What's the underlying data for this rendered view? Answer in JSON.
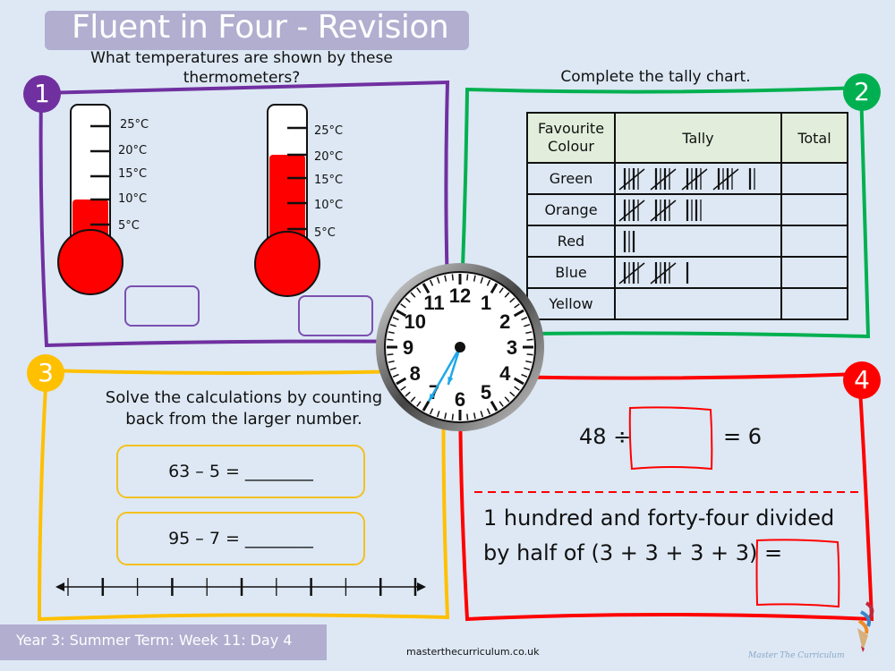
{
  "header": {
    "title": "Fluent in Four - Revision"
  },
  "colors": {
    "background": "#dde8f4",
    "section1": "#7030a0",
    "section2": "#00b050",
    "section3": "#ffc000",
    "section4": "#ff0000",
    "mercury": "#ff0000",
    "title_bar": "#b1aed0",
    "clock_hand": "#1fa7e8"
  },
  "section1": {
    "number": "1",
    "question": "What temperatures are shown by these thermometers?",
    "thermometers": [
      {
        "labels": [
          "25°C",
          "20°C",
          "15°C",
          "10°C",
          "5°C"
        ],
        "reading_celsius": 10,
        "answer": ""
      },
      {
        "labels": [
          "25°C",
          "20°C",
          "15°C",
          "10°C",
          "5°C"
        ],
        "reading_celsius": 20,
        "answer": ""
      }
    ]
  },
  "section2": {
    "number": "2",
    "question": "Complete the tally chart.",
    "table": {
      "headers": [
        "Favourite Colour",
        "Tally",
        "Total"
      ],
      "rows": [
        {
          "colour": "Green",
          "tally_count": 22,
          "total": ""
        },
        {
          "colour": "Orange",
          "tally_count": 14,
          "total": ""
        },
        {
          "colour": "Red",
          "tally_count": 3,
          "total": ""
        },
        {
          "colour": "Blue",
          "tally_count": 11,
          "total": ""
        },
        {
          "colour": "Yellow",
          "tally_count": 0,
          "total": ""
        }
      ]
    }
  },
  "clock": {
    "numbers": [
      "12",
      "1",
      "2",
      "3",
      "4",
      "5",
      "6",
      "7",
      "8",
      "9",
      "10",
      "11"
    ],
    "hour": 6,
    "minute": 35
  },
  "section3": {
    "number": "3",
    "question": "Solve the calculations by counting back from the larger number.",
    "calculations": [
      "63 – 5 = ________",
      "95 – 7 = ________"
    ],
    "number_line_ticks": 11
  },
  "section4": {
    "number": "4",
    "eq1_left": "48 ÷",
    "eq1_right": "= 6",
    "word_problem_line1": "1 hundred and forty-four divided",
    "word_problem_line2": "by half of (3 + 3 + 3 + 3) ="
  },
  "footer": {
    "lesson": "Year 3: Summer Term: Week 11: Day  4",
    "website": "masterthecurriculum.co.uk",
    "brand": "Master  The  Curriculum"
  }
}
